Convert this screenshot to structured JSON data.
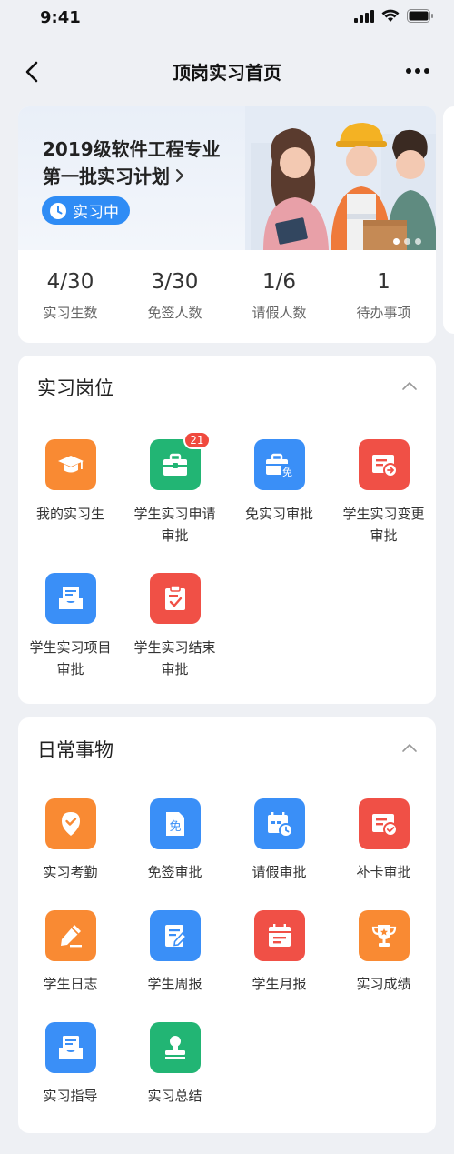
{
  "status_bar": {
    "time": "9:41"
  },
  "nav": {
    "title": "顶岗实习首页"
  },
  "plan": {
    "title_line1": "2019级软件工程专业",
    "title_line2": "第一批实习计划",
    "status": "实习中",
    "stats": [
      {
        "value": "4/30",
        "label": "实习生数"
      },
      {
        "value": "3/30",
        "label": "免签人数"
      },
      {
        "value": "1/6",
        "label": "请假人数"
      },
      {
        "value": "1",
        "label": "待办事项"
      }
    ]
  },
  "post_section": {
    "title": "实习岗位",
    "items": [
      {
        "label": "我的实习生",
        "icon": "graduation-cap-icon",
        "color": "#f98a33"
      },
      {
        "label": "学生实习申请审批",
        "icon": "briefcase-icon",
        "color": "#22b574",
        "badge": "21"
      },
      {
        "label": "免实习审批",
        "icon": "briefcase-exempt-icon",
        "color": "#3a8ff7"
      },
      {
        "label": "学生实习变更审批",
        "icon": "change-form-icon",
        "color": "#f05046"
      },
      {
        "label": "学生实习项目审批",
        "icon": "inbox-document-icon",
        "color": "#3a8ff7"
      },
      {
        "label": "学生实习结束审批",
        "icon": "clipboard-check-icon",
        "color": "#f05046"
      }
    ]
  },
  "daily_section": {
    "title": "日常事物",
    "items": [
      {
        "label": "实习考勤",
        "icon": "location-pin-icon",
        "color": "#f98a33"
      },
      {
        "label": "免签审批",
        "icon": "exempt-document-icon",
        "color": "#3a8ff7"
      },
      {
        "label": "请假审批",
        "icon": "calendar-clock-icon",
        "color": "#3a8ff7"
      },
      {
        "label": "补卡审批",
        "icon": "card-check-icon",
        "color": "#f05046"
      },
      {
        "label": "学生日志",
        "icon": "pencil-icon",
        "color": "#f98a33"
      },
      {
        "label": "学生周报",
        "icon": "edit-document-icon",
        "color": "#3a8ff7"
      },
      {
        "label": "学生月报",
        "icon": "calendar-icon",
        "color": "#f05046"
      },
      {
        "label": "实习成绩",
        "icon": "trophy-icon",
        "color": "#f98a33"
      },
      {
        "label": "实习指导",
        "icon": "inbox-document-icon",
        "color": "#3a8ff7"
      },
      {
        "label": "实习总结",
        "icon": "stamp-icon",
        "color": "#22b574"
      }
    ]
  }
}
